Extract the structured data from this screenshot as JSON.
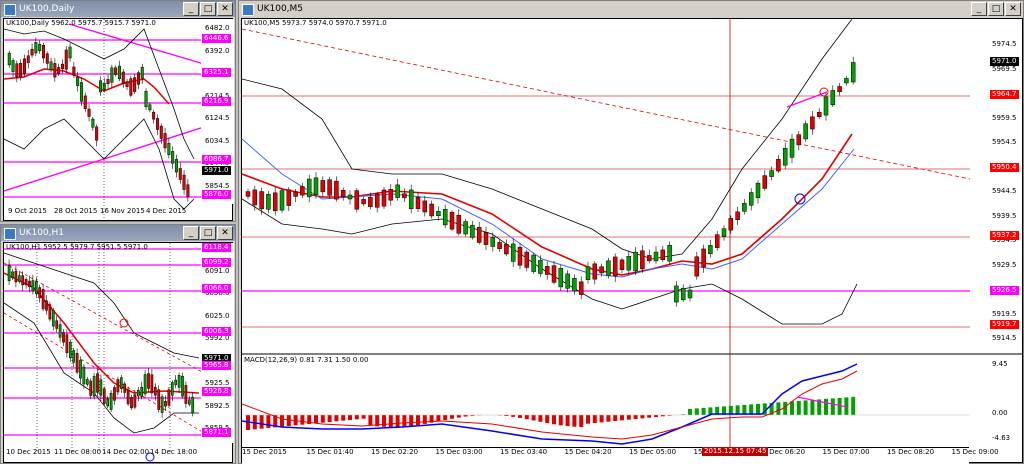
{
  "daily": {
    "title": "UK100,Daily",
    "header": "UK100,Daily  5962.0 5975.7 5915.7 5971.0",
    "axis": [
      "6482.0",
      "6392.0",
      "6304.5",
      "6214.5",
      "6124.5",
      "6034.5",
      "5944.5",
      "5854.5"
    ],
    "tags": [
      {
        "label": "6446.6",
        "color": "#ff00ff"
      },
      {
        "label": "6325.1",
        "color": "#ff00ff"
      },
      {
        "label": "6216.9",
        "color": "#ff00ff"
      },
      {
        "label": "6086.7",
        "color": "#ff00ff"
      },
      {
        "label": "5971.0",
        "color": "#000000"
      },
      {
        "label": "5876.0",
        "color": "#ff00ff"
      }
    ],
    "xlabels": [
      "9 Oct 2015",
      "28 Oct 2015",
      "16 Nov 2015",
      "4 Dec 2015"
    ]
  },
  "h1": {
    "title": "UK100,H1",
    "header": "UK100,H1  5952.5 5979.7 5951.5 5971.0",
    "axis": [
      "6124.5",
      "6091.0",
      "6058.0",
      "6025.0",
      "5992.0",
      "5958.5",
      "5925.5",
      "5892.5",
      "5859.5"
    ],
    "tags": [
      {
        "label": "6118.4",
        "color": "#ff00ff"
      },
      {
        "label": "6099.2",
        "color": "#ff00ff"
      },
      {
        "label": "6066.0",
        "color": "#ff00ff"
      },
      {
        "label": "6006.3",
        "color": "#ff00ff"
      },
      {
        "label": "5971.0",
        "color": "#000000"
      },
      {
        "label": "5965.8",
        "color": "#ff00ff"
      },
      {
        "label": "5926.8",
        "color": "#ff00ff"
      },
      {
        "label": "5871.1",
        "color": "#ff00ff"
      }
    ],
    "xlabels": [
      "10 Dec 2015",
      "11 Dec 08:00",
      "14 Dec 02:00",
      "14 Dec 18:00"
    ]
  },
  "m5": {
    "title": "UK100,M5",
    "header": "UK100,M5  5973.7 5974.0 5970.7 5971.0",
    "axis": [
      "5974.5",
      "5969.5",
      "5964.5",
      "5959.5",
      "5954.5",
      "5949.5",
      "5944.5",
      "5939.5",
      "5934.5",
      "5929.5",
      "5924.5",
      "5919.5",
      "5914.5"
    ],
    "tags": [
      {
        "label": "5971.0",
        "color": "#000000"
      },
      {
        "label": "5964.7",
        "color": "#ff0000"
      },
      {
        "label": "5950.4",
        "color": "#ff0000"
      },
      {
        "label": "5937.2",
        "color": "#ff0000"
      },
      {
        "label": "5926.5",
        "color": "#ff00ff"
      },
      {
        "label": "5919.7",
        "color": "#ff0000"
      }
    ],
    "macd_header": "MACD(12,26,9) 0.81 7.31 1.50 0.00",
    "macd_axis": [
      "9.45",
      "0.00",
      "-4.63"
    ],
    "xlabels": [
      "15 Dec 2015",
      "15 Dec 01:40",
      "15 Dec 02:20",
      "15 Dec 03:00",
      "15 Dec 03:40",
      "15 Dec 04:20",
      "15 Dec 05:00",
      "15 Dec 05:40",
      "15 Dec 06:20",
      "15 Dec 07:00",
      "15 Dec 08:20",
      "15 Dec 09:00"
    ],
    "crosshair_time": "2015.12.15 07:45"
  }
}
